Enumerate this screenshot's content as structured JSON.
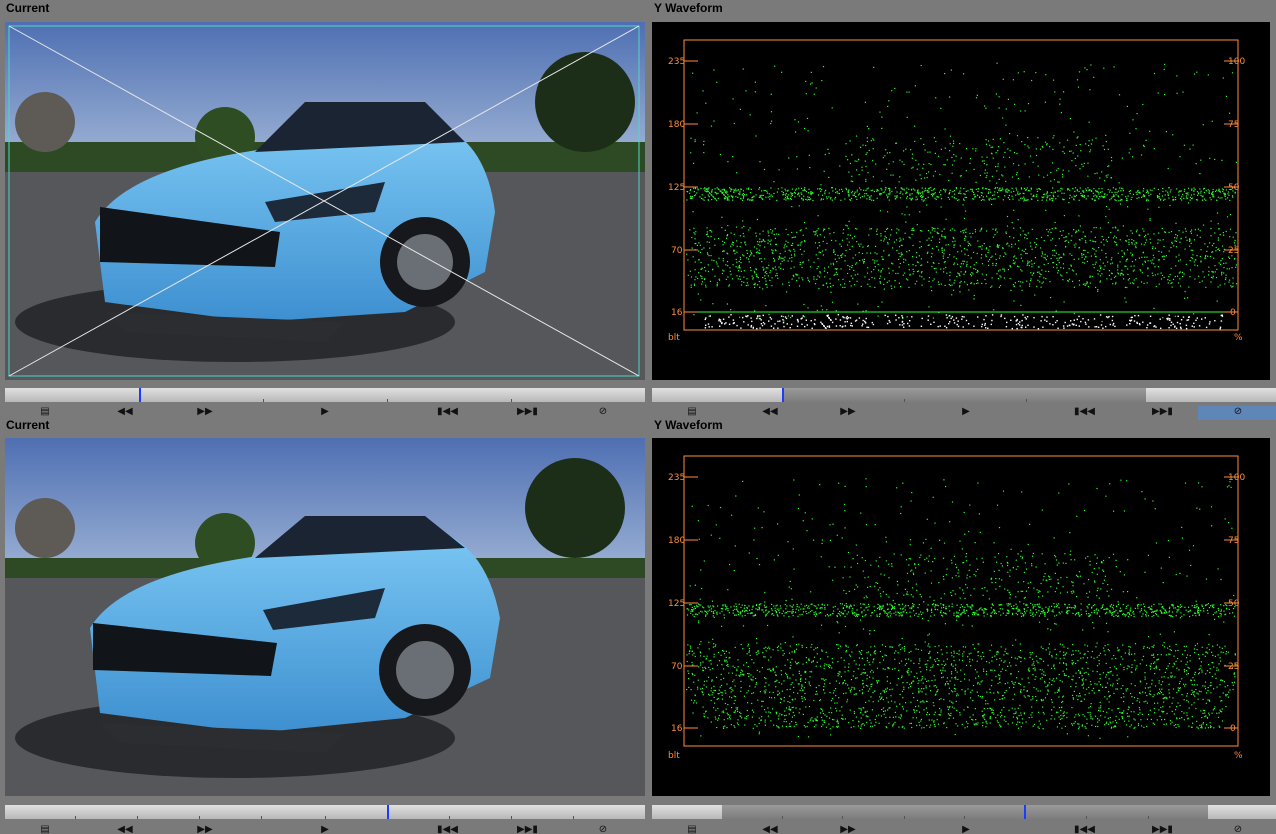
{
  "panels": {
    "top_left_title": "Current",
    "top_right_title": "Y Waveform",
    "bottom_left_title": "Current",
    "bottom_right_title": "Y Waveform"
  },
  "waveform": {
    "left_ticks": [
      "235",
      "180",
      "125",
      "70",
      "16"
    ],
    "right_ticks": [
      "100",
      "75",
      "50",
      "25",
      "0"
    ],
    "left_unit": "blt",
    "right_unit": "%",
    "trace_color": "#2bff2b",
    "frame_color": "#ff8c3a",
    "clip_color": "#ffffff"
  },
  "transport": {
    "icons": [
      "marker-icon",
      "step-back-icon",
      "step-forward-icon",
      "play-icon",
      "jump-start-icon",
      "jump-end-icon",
      "no-entry-icon"
    ],
    "top_left_playhead": 0.21,
    "top_right_playhead": 0.21,
    "bottom_left_playhead": 0.6,
    "bottom_right_playhead": 0.6
  },
  "scene": {
    "sky_color": "#5a78b4",
    "car_color": "#5ab4ef"
  }
}
